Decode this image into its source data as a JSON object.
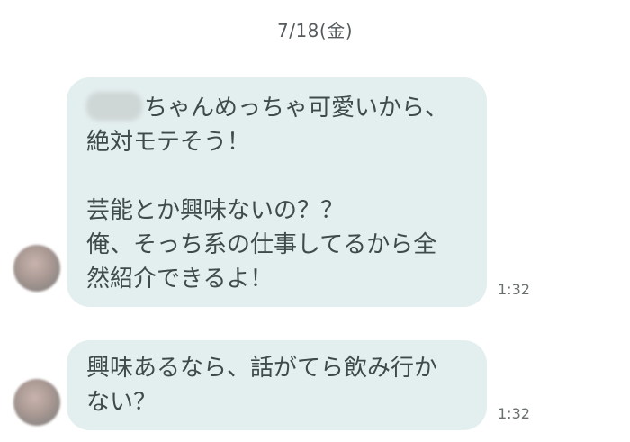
{
  "chat": {
    "date_separator": "7/18(金)",
    "messages": [
      {
        "sender": "other",
        "lines": [
          "ちゃんめっちゃ可愛いから、",
          "絶対モテそう！",
          "",
          "芸能とか興味ないの？？",
          "俺、そっち系の仕事してるから全",
          "然紹介できるよ！"
        ],
        "time": "1:32"
      },
      {
        "sender": "other",
        "lines": [
          "興味あるなら、話がてら飲み行か",
          "ない？"
        ],
        "time": "1:32"
      }
    ]
  },
  "colors": {
    "bubble_background": "#e3eeee",
    "message_text": "#3f4a4a",
    "timestamp_text": "#6a7070",
    "page_background": "#ffffff"
  },
  "icons": {
    "avatar": "blurred-avatar-icon",
    "redaction": "blurred-name-redaction"
  }
}
